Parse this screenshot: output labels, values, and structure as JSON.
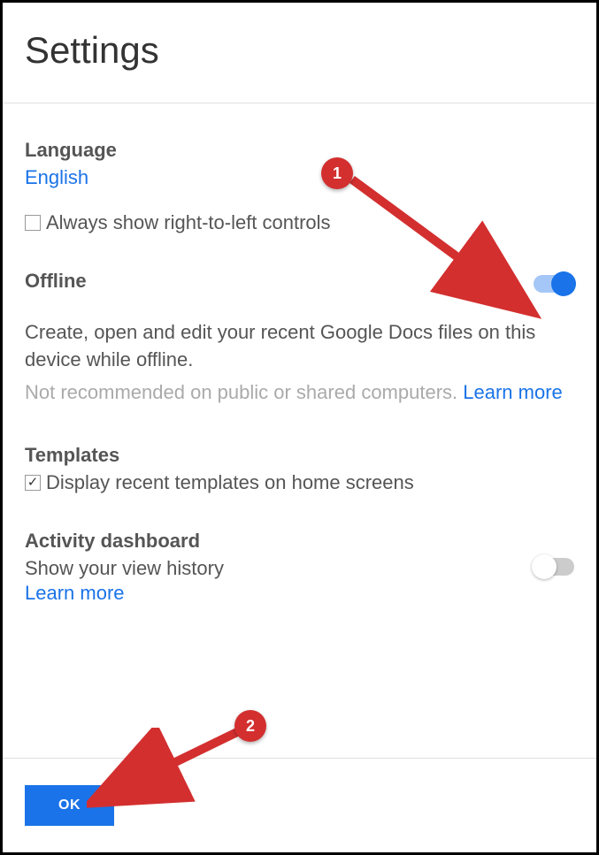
{
  "header": {
    "title": "Settings"
  },
  "language": {
    "title": "Language",
    "value": "English",
    "rtl_checkbox_label": "Always show right-to-left controls"
  },
  "offline": {
    "title": "Offline",
    "description": "Create, open and edit your recent Google Docs files on this device while offline.",
    "note": "Not recommended on public or shared computers. ",
    "learn_more": "Learn more"
  },
  "templates": {
    "title": "Templates",
    "checkbox_label": "Display recent templates on home screens"
  },
  "activity": {
    "title": "Activity dashboard",
    "description": "Show your view history",
    "learn_more": "Learn more"
  },
  "footer": {
    "ok_label": "OK"
  },
  "annotations": {
    "badge1": "1",
    "badge2": "2"
  }
}
